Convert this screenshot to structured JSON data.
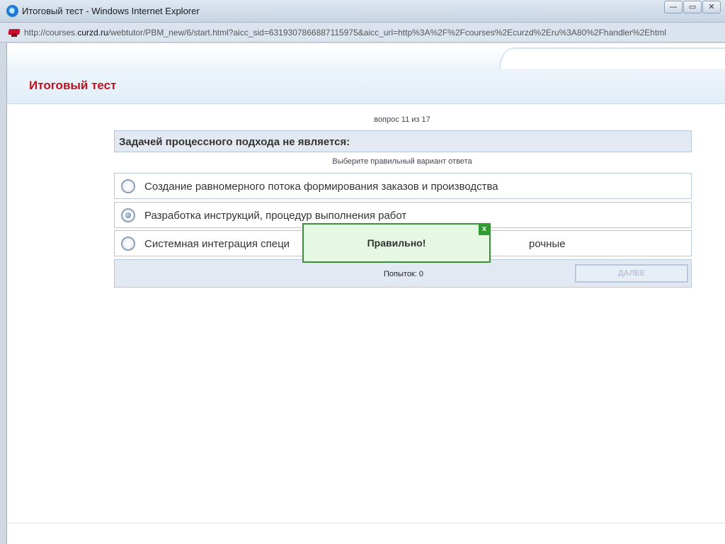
{
  "window": {
    "title": "Итоговый тест - Windows Internet Explorer",
    "minimize": "—",
    "maximize": "▭",
    "close": "✕"
  },
  "address": {
    "prefix": "http://courses.",
    "domain": "curzd.ru",
    "rest": "/webtutor/PBM_new/6/start.html?aicc_sid=6319307866887115975&aicc_url=http%3A%2F%2Fcourses%2Ecurzd%2Eru%3A80%2Fhandler%2Ehtml"
  },
  "page": {
    "title": "Итоговый тест"
  },
  "quiz": {
    "counter": "вопрос 11 из 17",
    "question": "Задачей процессного подхода не является:",
    "instruction": "Выберите правильный вариант ответа",
    "options": [
      {
        "label": "Создание равномерного потока формирования заказов и производства",
        "checked": false
      },
      {
        "label": "Разработка инструкций, процедур выполнения работ",
        "checked": true
      },
      {
        "label": "Системная интеграция специалистов, работающих в различных подразделениях, в процессные команды, работающие на клиента и на проектные и срочные",
        "label_visible_left": "Системная интеграция специ",
        "label_visible_right": "рочные",
        "checked": false
      }
    ],
    "attempts": "Попыток: 0",
    "next_button": "ДАЛЕЕ"
  },
  "popup": {
    "message": "Правильно!",
    "close": "x"
  }
}
